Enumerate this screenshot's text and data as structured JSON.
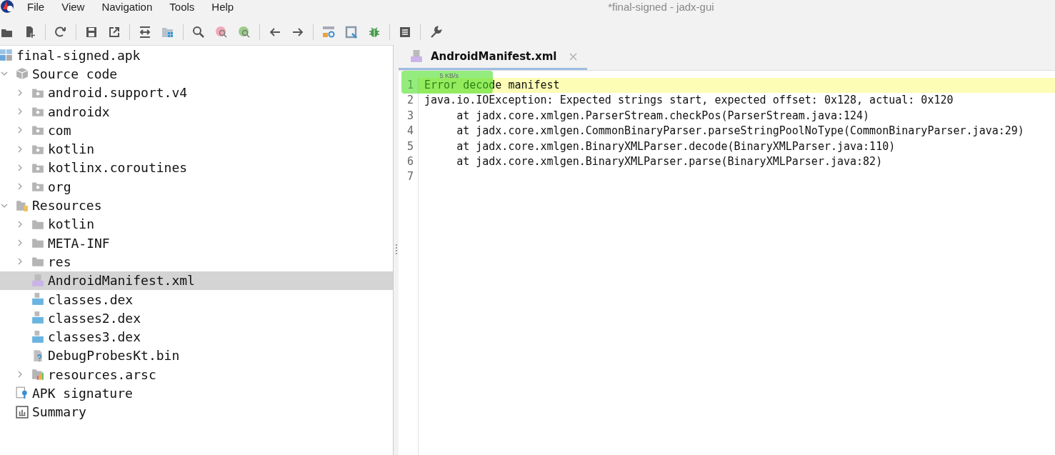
{
  "menu": [
    "File",
    "View",
    "Navigation",
    "Tools",
    "Help"
  ],
  "window": {
    "title": "*final-signed - jadx-gui"
  },
  "tree": [
    {
      "label": "final-signed.apk",
      "kind": "apk",
      "selected": false,
      "children": [
        {
          "label": "Source code",
          "kind": "source",
          "expanded": true,
          "selected": false,
          "children": [
            {
              "label": "android.support.v4",
              "kind": "package",
              "expanded": false,
              "selected": false
            },
            {
              "label": "androidx",
              "kind": "package",
              "expanded": false,
              "selected": false
            },
            {
              "label": "com",
              "kind": "package",
              "expanded": false,
              "selected": false
            },
            {
              "label": "kotlin",
              "kind": "package",
              "expanded": false,
              "selected": false
            },
            {
              "label": "kotlinx.coroutines",
              "kind": "package",
              "expanded": false,
              "selected": false
            },
            {
              "label": "org",
              "kind": "package",
              "expanded": false,
              "selected": false
            }
          ]
        },
        {
          "label": "Resources",
          "kind": "resources",
          "expanded": true,
          "selected": false,
          "children": [
            {
              "label": "kotlin",
              "kind": "folder",
              "expanded": false,
              "selected": false
            },
            {
              "label": "META-INF",
              "kind": "folder",
              "expanded": false,
              "selected": false
            },
            {
              "label": "res",
              "kind": "folder",
              "expanded": false,
              "selected": false
            },
            {
              "label": "AndroidManifest.xml",
              "kind": "manifest",
              "selected": true
            },
            {
              "label": "classes.dex",
              "kind": "dex",
              "selected": false
            },
            {
              "label": "classes2.dex",
              "kind": "dex",
              "selected": false
            },
            {
              "label": "classes3.dex",
              "kind": "dex",
              "selected": false
            },
            {
              "label": "DebugProbesKt.bin",
              "kind": "unknown",
              "selected": false
            },
            {
              "label": "resources.arsc",
              "kind": "arsc",
              "expanded": false,
              "selected": false
            }
          ]
        },
        {
          "label": "APK signature",
          "kind": "signature",
          "selected": false
        },
        {
          "label": "Summary",
          "kind": "summary",
          "selected": false
        }
      ]
    }
  ],
  "editor": {
    "tabs": [
      {
        "label": "AndroidManifest.xml",
        "selected": true
      }
    ],
    "lines": [
      {
        "number": "1",
        "text": "Error decode manifest",
        "highlighted": true
      },
      {
        "number": "2",
        "text": "java.io.IOException: Expected strings start, expected offset: 0x128, actual: 0x120",
        "highlighted": false
      },
      {
        "number": "3",
        "text": "     at jadx.core.xmlgen.ParserStream.checkPos(ParserStream.java:124)",
        "highlighted": false
      },
      {
        "number": "4",
        "text": "     at jadx.core.xmlgen.CommonBinaryParser.parseStringPoolNoType(CommonBinaryParser.java:29)",
        "highlighted": false
      },
      {
        "number": "5",
        "text": "     at jadx.core.xmlgen.BinaryXMLParser.decode(BinaryXMLParser.java:110)",
        "highlighted": false
      },
      {
        "number": "6",
        "text": "     at jadx.core.xmlgen.BinaryXMLParser.parse(BinaryXMLParser.java:82)",
        "highlighted": false
      },
      {
        "number": "7",
        "highlighted": false
      }
    ]
  },
  "speed_overlay": {
    "reading": "5 KB/s"
  }
}
